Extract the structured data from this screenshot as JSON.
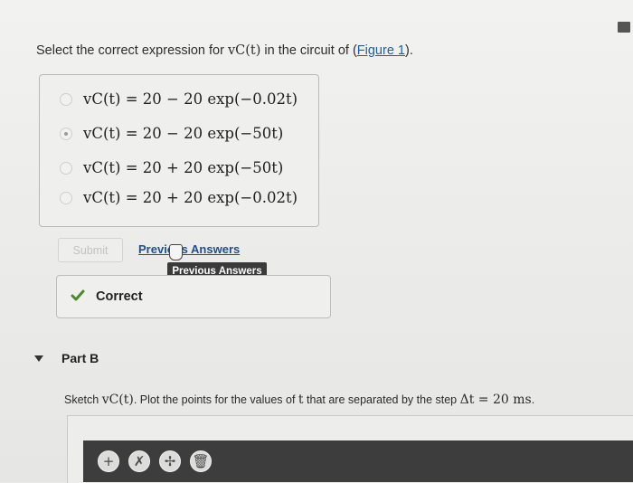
{
  "question": {
    "prefix": "Select the correct expression for ",
    "var": "vC(t)",
    "middle": " in the circuit of (",
    "link": "Figure 1",
    "suffix": ")."
  },
  "options": [
    {
      "text": "vC(t) = 20 − 20 exp(−0.02t)",
      "selected": false
    },
    {
      "text": "vC(t) = 20 − 20 exp(−50t)",
      "selected": true
    },
    {
      "text": "vC(t) = 20 + 20 exp(−50t)",
      "selected": false
    },
    {
      "text": "vC(t) = 20 + 20 exp(−0.02t)",
      "selected": false
    }
  ],
  "submit_label": "Submit",
  "previous_answers_link": "Previous Answers",
  "tooltip": "Previous Answers",
  "feedback": "Correct",
  "part_b": {
    "label": "Part B",
    "instruction_prefix": "Sketch ",
    "instruction_var": "vC(t)",
    "instruction_middle": ". Plot the points for the values of ",
    "instruction_t": "t",
    "instruction_suffix": " that are separated by the step ",
    "step": "Δt = 20 ms",
    "instruction_end": "."
  },
  "tool_icons": [
    "plus-icon",
    "cross-icon",
    "move-icon",
    "trash-icon"
  ]
}
